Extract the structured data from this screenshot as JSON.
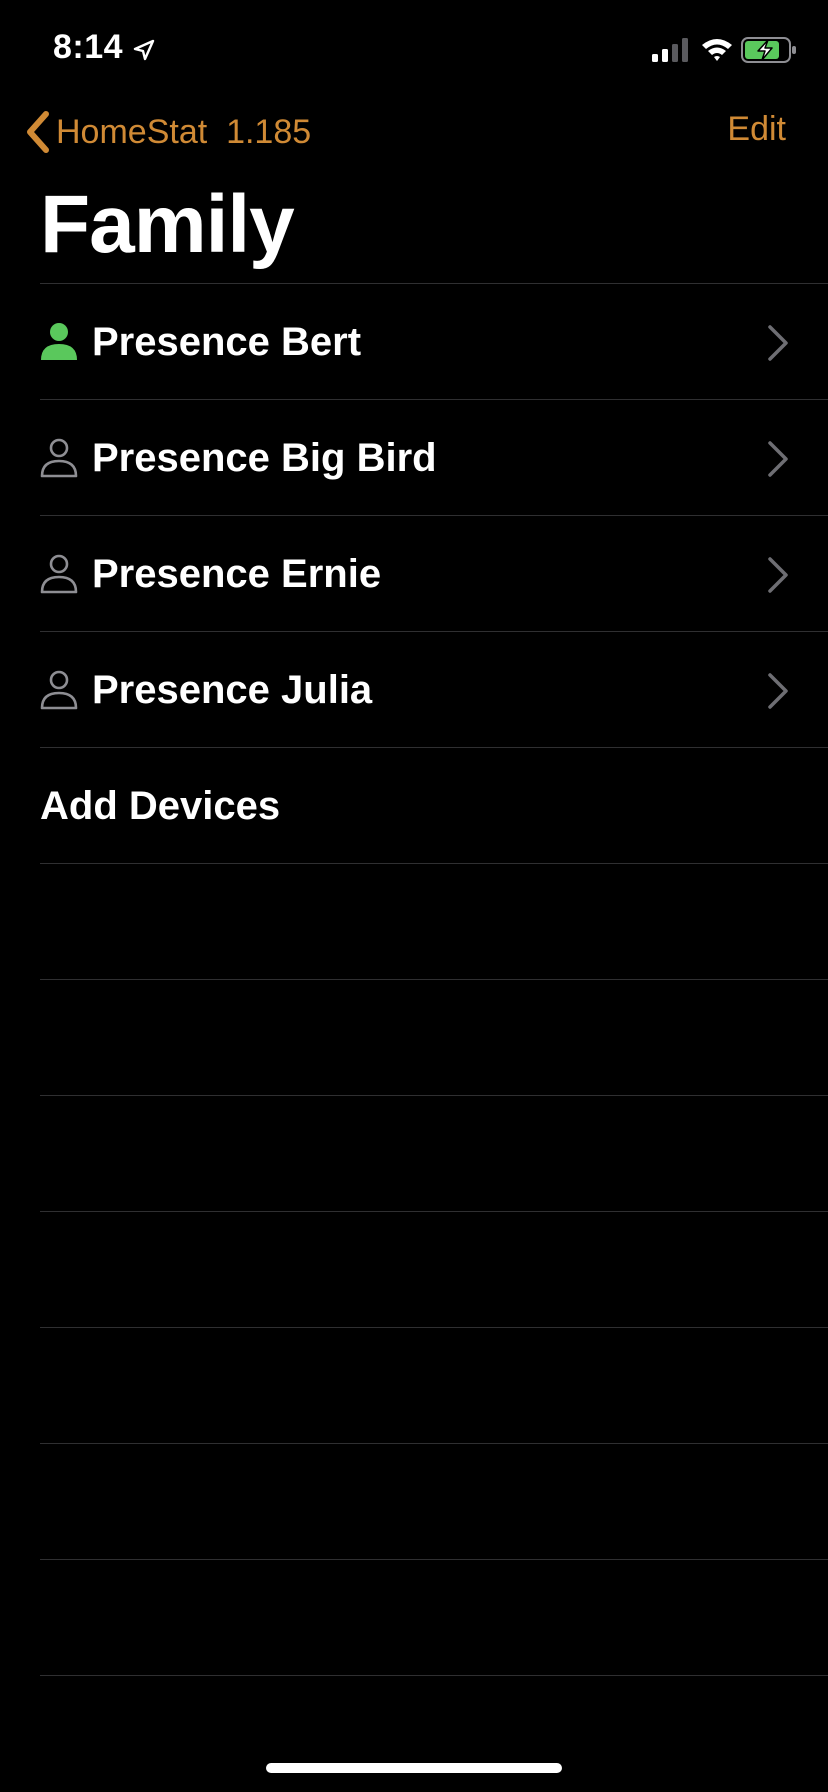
{
  "status_bar": {
    "time": "8:14",
    "icons": [
      "location-arrow-icon",
      "cellular-signal-icon",
      "wifi-icon",
      "battery-charging-icon"
    ]
  },
  "nav": {
    "back_label": "HomeStat  1.185",
    "edit_label": "Edit",
    "title": "Family"
  },
  "colors": {
    "accent": "#d08a35",
    "present": "#5ac85c",
    "absent": "#8e8e93",
    "separator": "#2f2f31",
    "background": "#000000"
  },
  "family": {
    "items": [
      {
        "label": "Presence Bert",
        "present": true
      },
      {
        "label": "Presence Big Bird",
        "present": false
      },
      {
        "label": "Presence Ernie",
        "present": false
      },
      {
        "label": "Presence Julia",
        "present": false
      }
    ],
    "add_label": "Add Devices"
  }
}
